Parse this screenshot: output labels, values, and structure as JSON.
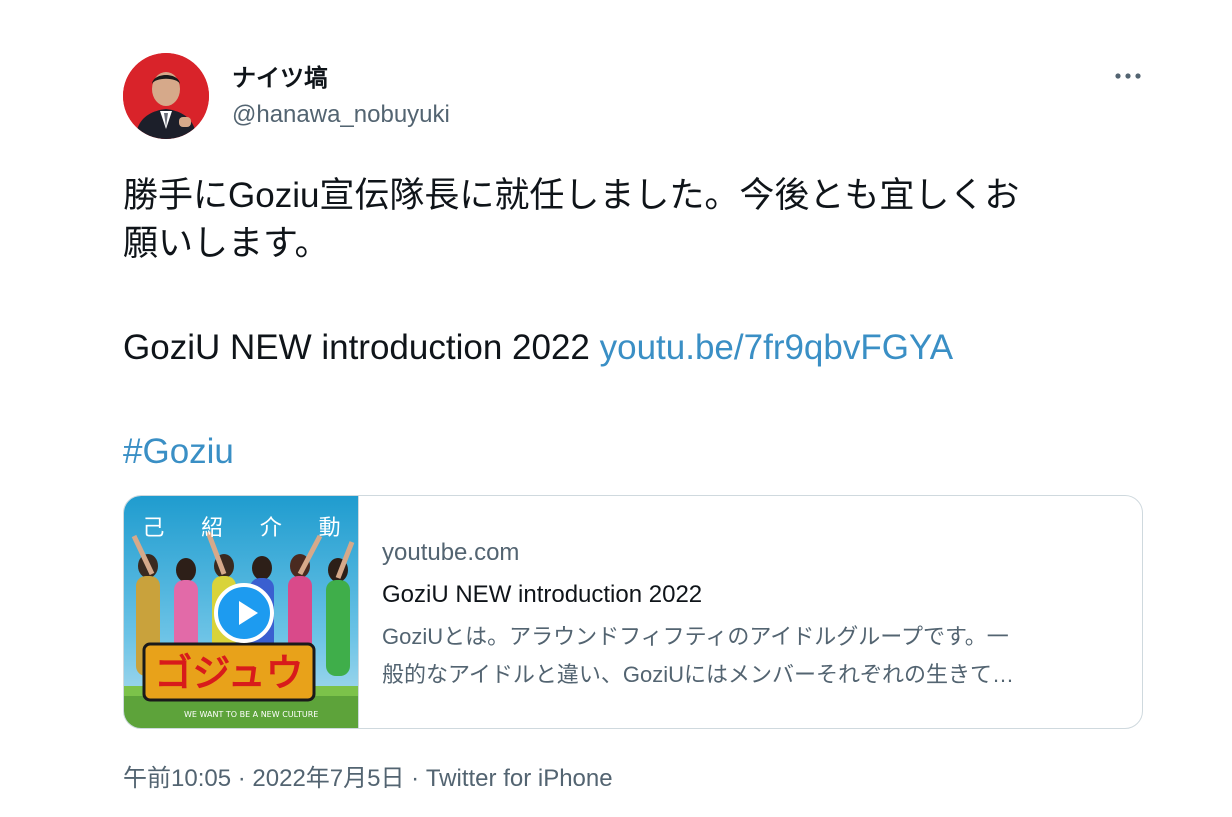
{
  "tweet": {
    "author": {
      "display_name": "ナイツ塙",
      "handle": "@hanawa_nobuyuki"
    },
    "text_lines": [
      "勝手にGoziu宣伝隊長に就任しました。今後とも宜しくお",
      "願いします。"
    ],
    "video_title": "GoziU NEW introduction 2022",
    "link_text": "youtu.be/7fr9qbvFGYA",
    "hashtag": "#Goziu",
    "timestamp": "午前10:05",
    "date": "2022年7月5日",
    "source": "Twitter for iPhone",
    "separator": "·"
  },
  "card": {
    "domain": "youtube.com",
    "title": "GoziU NEW introduction 2022",
    "description_lines": [
      "GoziUとは。アラウンドフィフティのアイドルグループです。一",
      "般的なアイドルと違い、GoziUにはメンバーそれぞれの生きて…"
    ],
    "thumbnail_banner": [
      "己",
      "紹",
      "介",
      "動"
    ],
    "thumbnail_logo": "ゴジュウ",
    "thumbnail_tagline": "WE WANT TO BE A NEW CULTURE"
  },
  "icons": {
    "more": "more-horizontal-icon",
    "play": "play-icon"
  },
  "colors": {
    "link": "#3a8fc5",
    "secondary_text": "#536471",
    "avatar_bg": "#d9232a",
    "border": "#cfd9de"
  }
}
